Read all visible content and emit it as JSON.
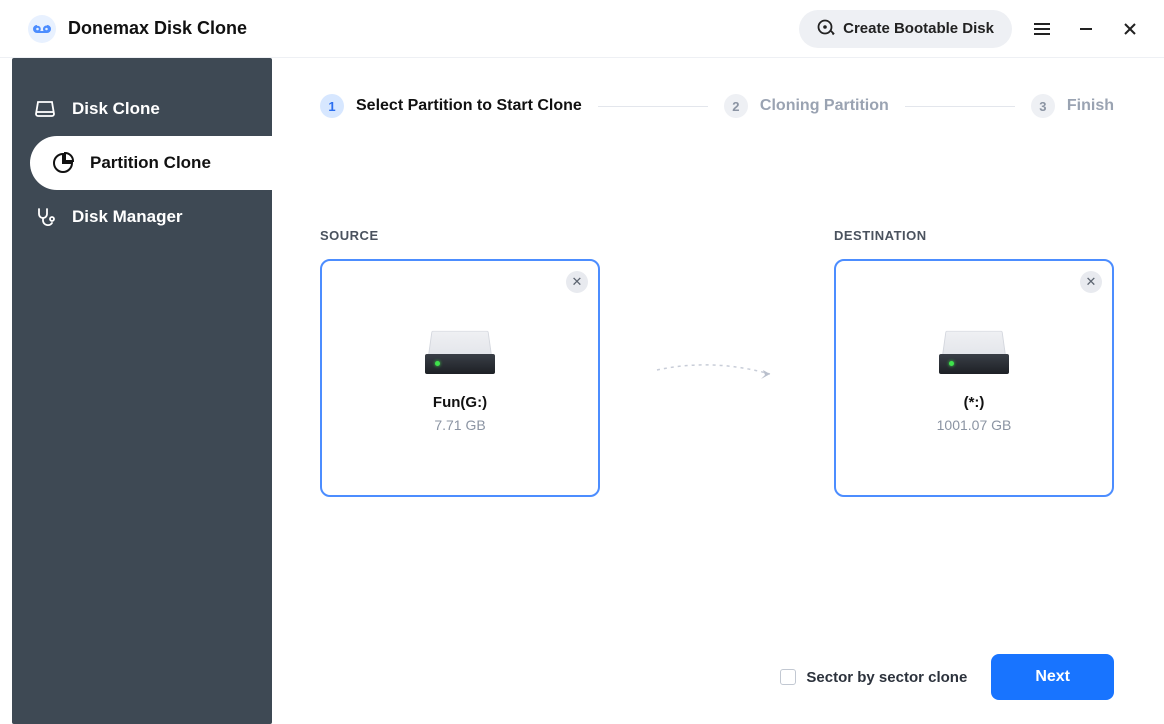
{
  "app": {
    "title": "Donemax Disk Clone"
  },
  "titlebar": {
    "bootable_label": "Create Bootable Disk"
  },
  "sidebar": {
    "items": [
      {
        "label": "Disk Clone"
      },
      {
        "label": "Partition Clone"
      },
      {
        "label": "Disk Manager"
      }
    ],
    "active_index": 1
  },
  "steps": [
    {
      "num": "1",
      "label": "Select Partition to Start Clone",
      "active": true
    },
    {
      "num": "2",
      "label": "Cloning Partition",
      "active": false
    },
    {
      "num": "3",
      "label": "Finish",
      "active": false
    }
  ],
  "source": {
    "title": "SOURCE",
    "drive_name": "Fun(G:)",
    "drive_size": "7.71 GB"
  },
  "destination": {
    "title": "DESTINATION",
    "drive_name": "(*:)",
    "drive_size": "1001.07 GB"
  },
  "footer": {
    "sector_label": "Sector by sector clone",
    "next_label": "Next"
  }
}
